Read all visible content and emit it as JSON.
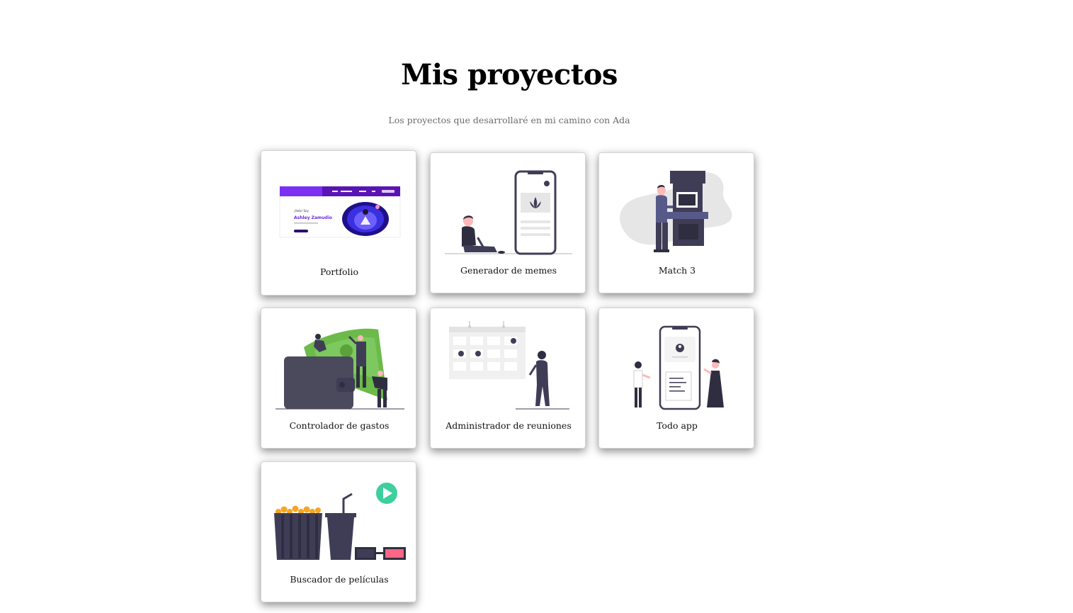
{
  "header": {
    "title": "Mis proyectos",
    "subtitle": "Los proyectos que desarrollaré en mi camino con Ada"
  },
  "projects": [
    {
      "label": "Portfolio",
      "illustration": "portfolio-screenshot"
    },
    {
      "label": "Generador de memes",
      "illustration": "person-with-phone"
    },
    {
      "label": "Match 3",
      "illustration": "arcade-machine"
    },
    {
      "label": "Controlador de gastos",
      "illustration": "wallet-with-cash"
    },
    {
      "label": "Administrador de reuniones",
      "illustration": "calendar-with-person"
    },
    {
      "label": "Todo app",
      "illustration": "phone-with-people"
    },
    {
      "label": "Buscador de películas",
      "illustration": "popcorn-drink-glasses"
    }
  ],
  "portfolio_preview": {
    "hello_text": "¡Hola! Soy",
    "name_text": "Ashley Zamudio"
  },
  "colors": {
    "accent_purple": "#6c2bd9",
    "illustration_dark": "#3f3d56",
    "money_green": "#6cba4a",
    "play_teal": "#3ecf9e",
    "popcorn_orange": "#f5a623",
    "glasses_pink": "#ff6584"
  }
}
